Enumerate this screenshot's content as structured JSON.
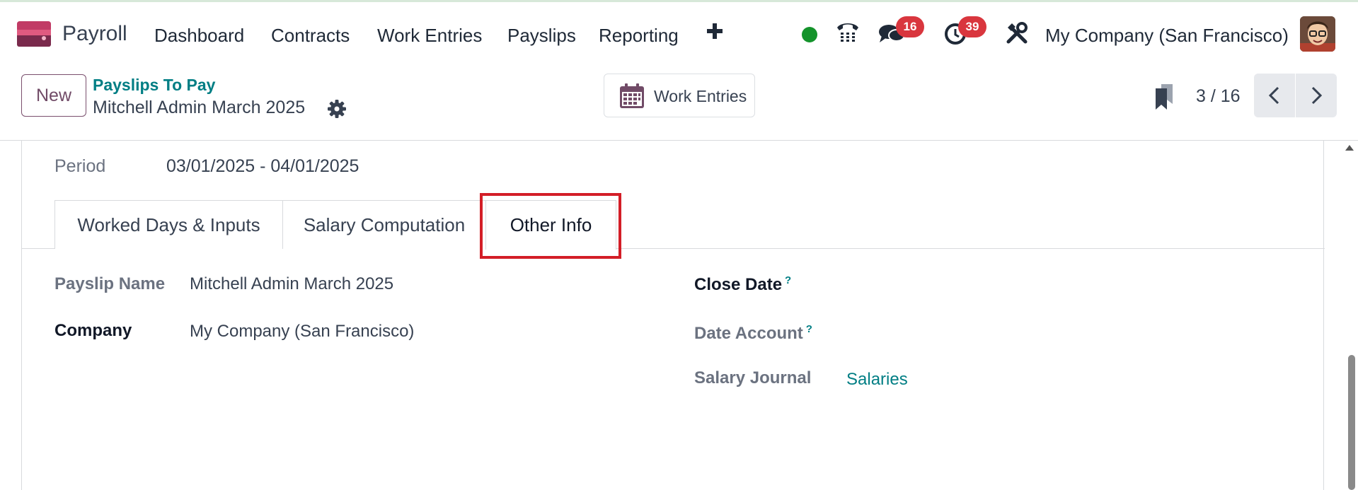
{
  "navbar": {
    "app_name": "Payroll",
    "menu": [
      "Dashboard",
      "Contracts",
      "Work Entries",
      "Payslips",
      "Reporting"
    ],
    "messages_count": "16",
    "activities_count": "39",
    "company": "My Company (San Francisco)"
  },
  "control": {
    "new_label": "New",
    "breadcrumb": "Payslips To Pay",
    "record_title": "Mitchell Admin March 2025",
    "work_entries_label": "Work Entries",
    "pager": "3 / 16"
  },
  "sheet": {
    "period_label": "Period",
    "period_value": "03/01/2025 - 04/01/2025",
    "tabs": [
      "Worked Days & Inputs",
      "Salary Computation",
      "Other Info"
    ],
    "fields": {
      "payslip_name_label": "Payslip Name",
      "payslip_name_value": "Mitchell Admin March 2025",
      "company_label": "Company",
      "company_value": "My Company (San Francisco)",
      "close_date_label": "Close Date",
      "date_account_label": "Date Account",
      "salary_journal_label": "Salary Journal",
      "salary_journal_value": "Salaries",
      "help_mark": "?"
    }
  },
  "colors": {
    "brand": "#714b67",
    "link": "#017e84",
    "badge": "#d9363e",
    "status_online": "#14932b",
    "highlight": "#d31e27"
  }
}
